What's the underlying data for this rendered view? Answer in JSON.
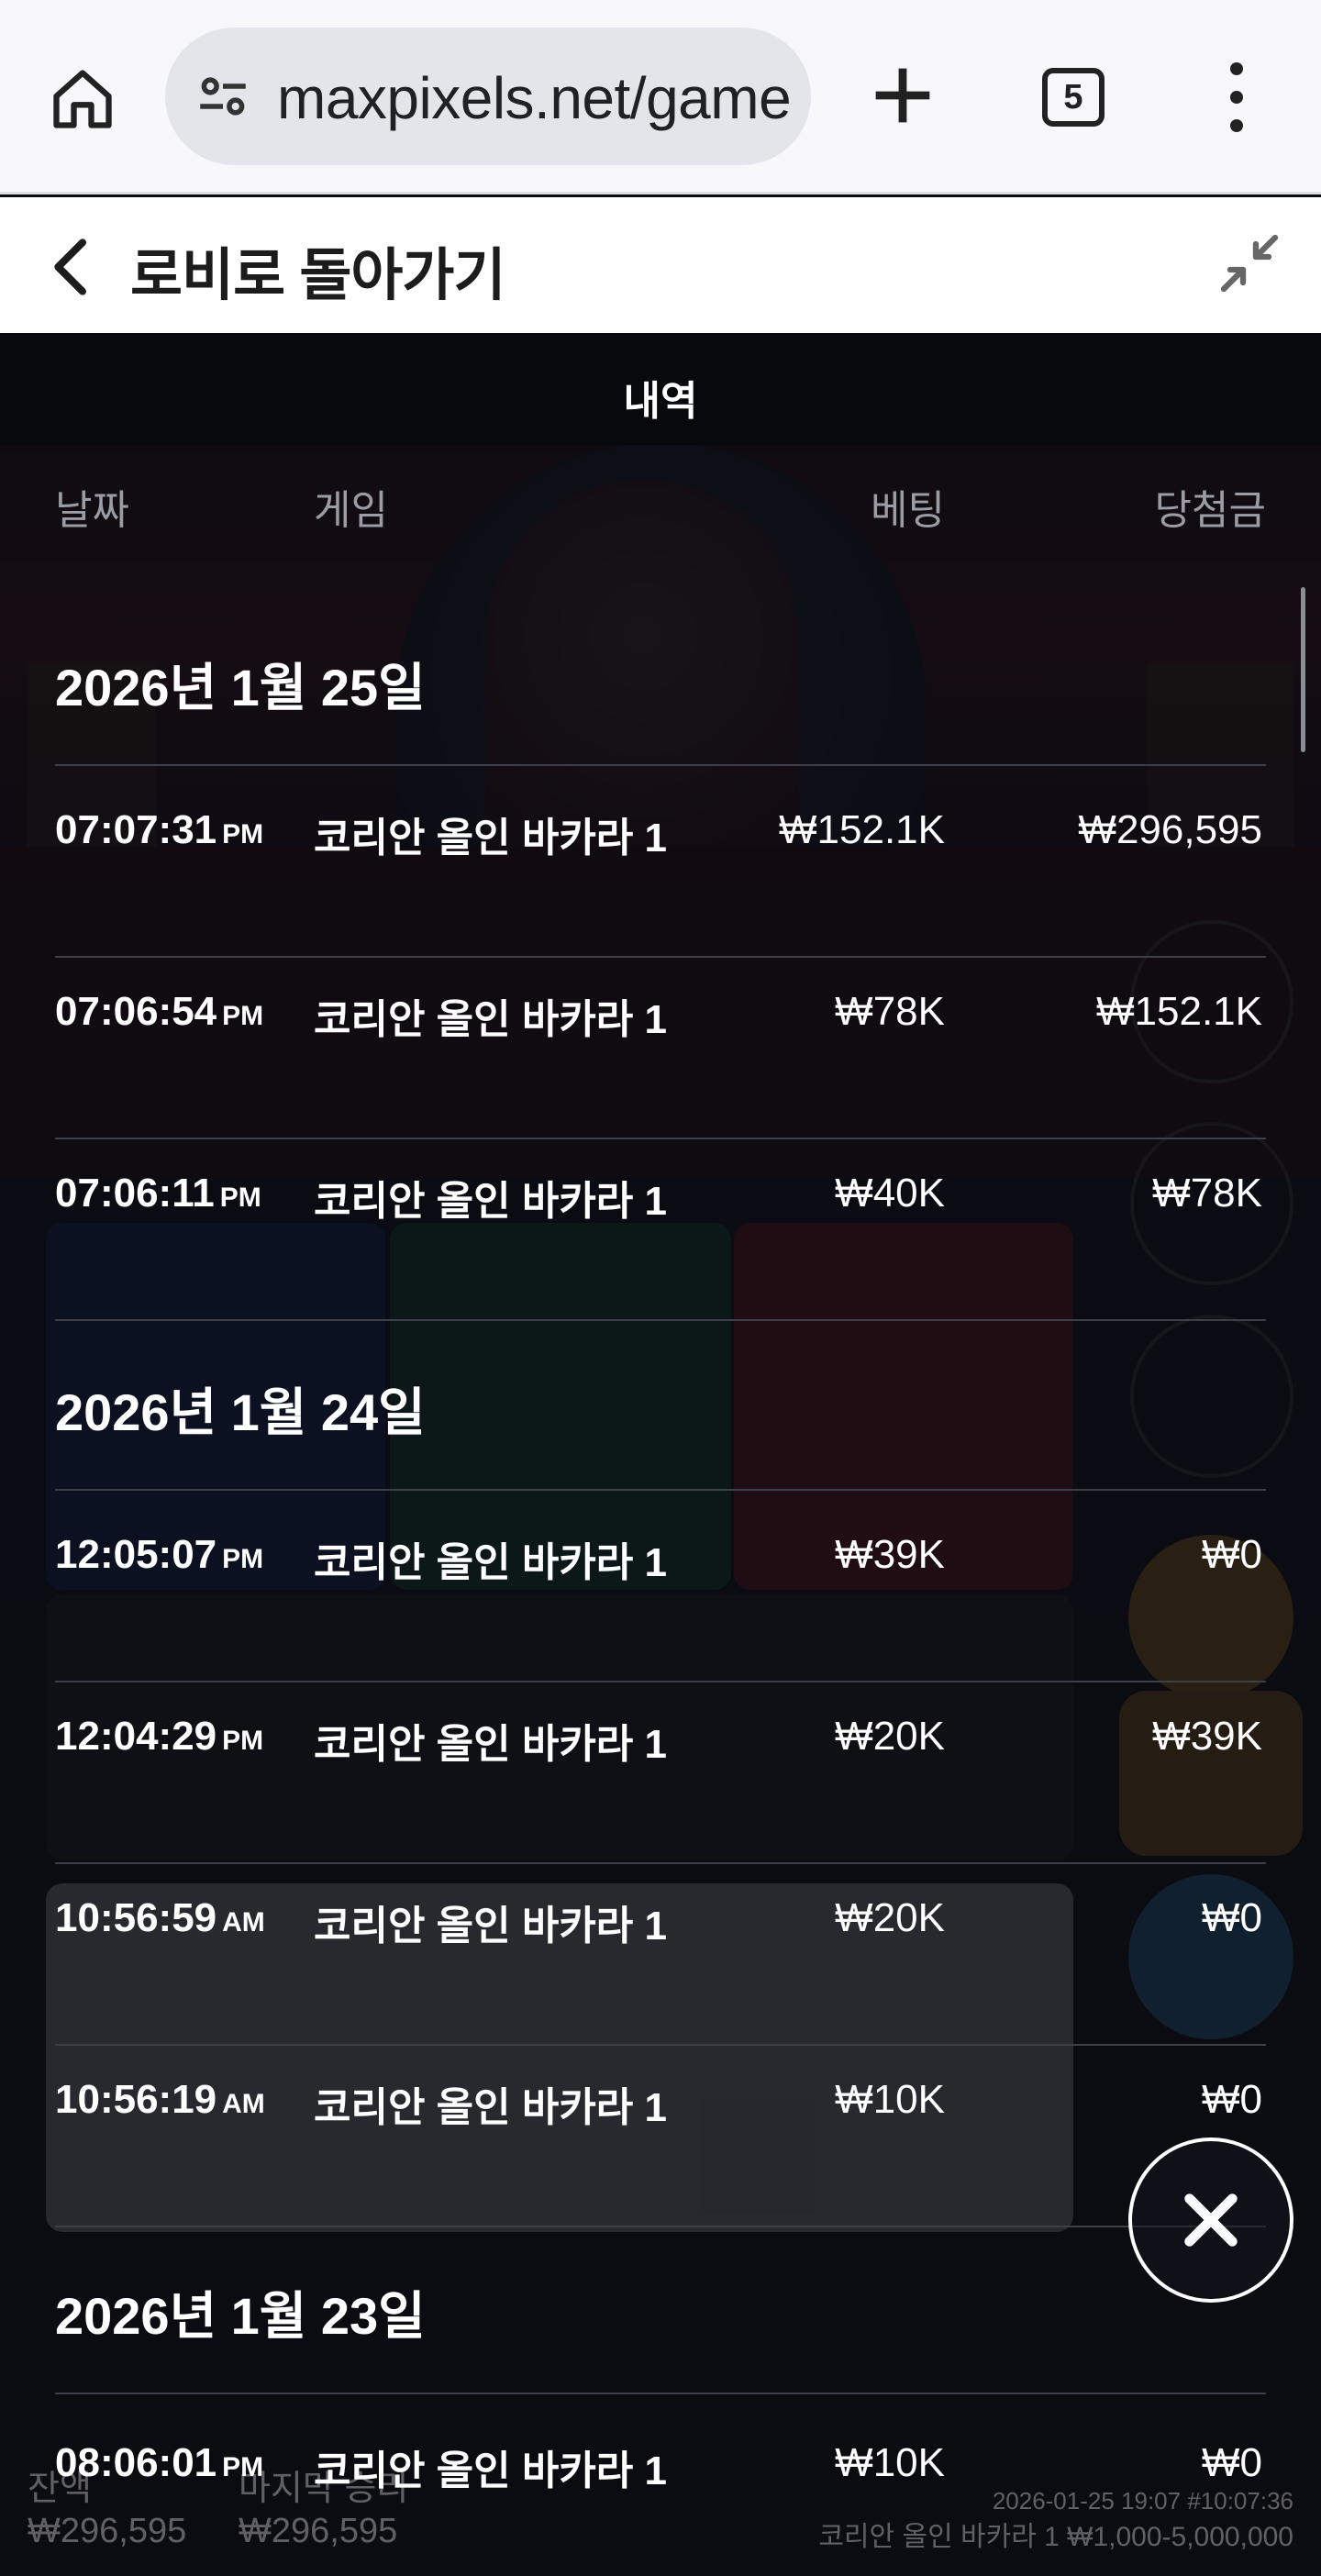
{
  "browser": {
    "url": "maxpixels.net/game",
    "tab_count": "5"
  },
  "lobby": {
    "back_label": "로비로 돌아가기"
  },
  "history": {
    "title": "내역",
    "columns": {
      "date": "날짜",
      "game": "게임",
      "bet": "베팅",
      "win": "당첨금"
    },
    "groups": [
      {
        "date": "2026년 1월 25일",
        "rows": [
          {
            "time": "07:07:31",
            "ampm": "PM",
            "game": "코리안 올인 바카라 1",
            "bet": "₩152.1K",
            "win": "₩296,595"
          },
          {
            "time": "07:06:54",
            "ampm": "PM",
            "game": "코리안 올인 바카라 1",
            "bet": "₩78K",
            "win": "₩152.1K"
          },
          {
            "time": "07:06:11",
            "ampm": "PM",
            "game": "코리안 올인 바카라 1",
            "bet": "₩40K",
            "win": "₩78K"
          }
        ]
      },
      {
        "date": "2026년 1월 24일",
        "rows": [
          {
            "time": "12:05:07",
            "ampm": "PM",
            "game": "코리안 올인 바카라 1",
            "bet": "₩39K",
            "win": "₩0"
          },
          {
            "time": "12:04:29",
            "ampm": "PM",
            "game": "코리안 올인 바카라 1",
            "bet": "₩20K",
            "win": "₩39K"
          },
          {
            "time": "10:56:59",
            "ampm": "AM",
            "game": "코리안 올인 바카라 1",
            "bet": "₩20K",
            "win": "₩0"
          },
          {
            "time": "10:56:19",
            "ampm": "AM",
            "game": "코리안 올인 바카라 1",
            "bet": "₩10K",
            "win": "₩0"
          }
        ]
      },
      {
        "date": "2026년 1월 23일",
        "rows": [
          {
            "time": "08:06:01",
            "ampm": "PM",
            "game": "코리안 올인 바카라 1",
            "bet": "₩10K",
            "win": "₩0"
          }
        ]
      }
    ]
  },
  "footer": {
    "balance_label": "잔액",
    "balance_value": "₩296,595",
    "last_win_label": "마지막 승리",
    "last_win_value": "₩296,595",
    "timestamp": "2026-01-25 19:07 #10:07:36",
    "table_info": "코리안 올인 바카라 1 ₩1,000-5,000,000"
  },
  "icons": {
    "home": "home-icon",
    "site_info": "tune-icon",
    "new_tab": "plus-icon",
    "tabs": "tab-switcher-icon",
    "menu": "more-vert-icon",
    "back": "chevron-left-icon",
    "minimize": "minimize-icon",
    "close": "close-icon"
  }
}
